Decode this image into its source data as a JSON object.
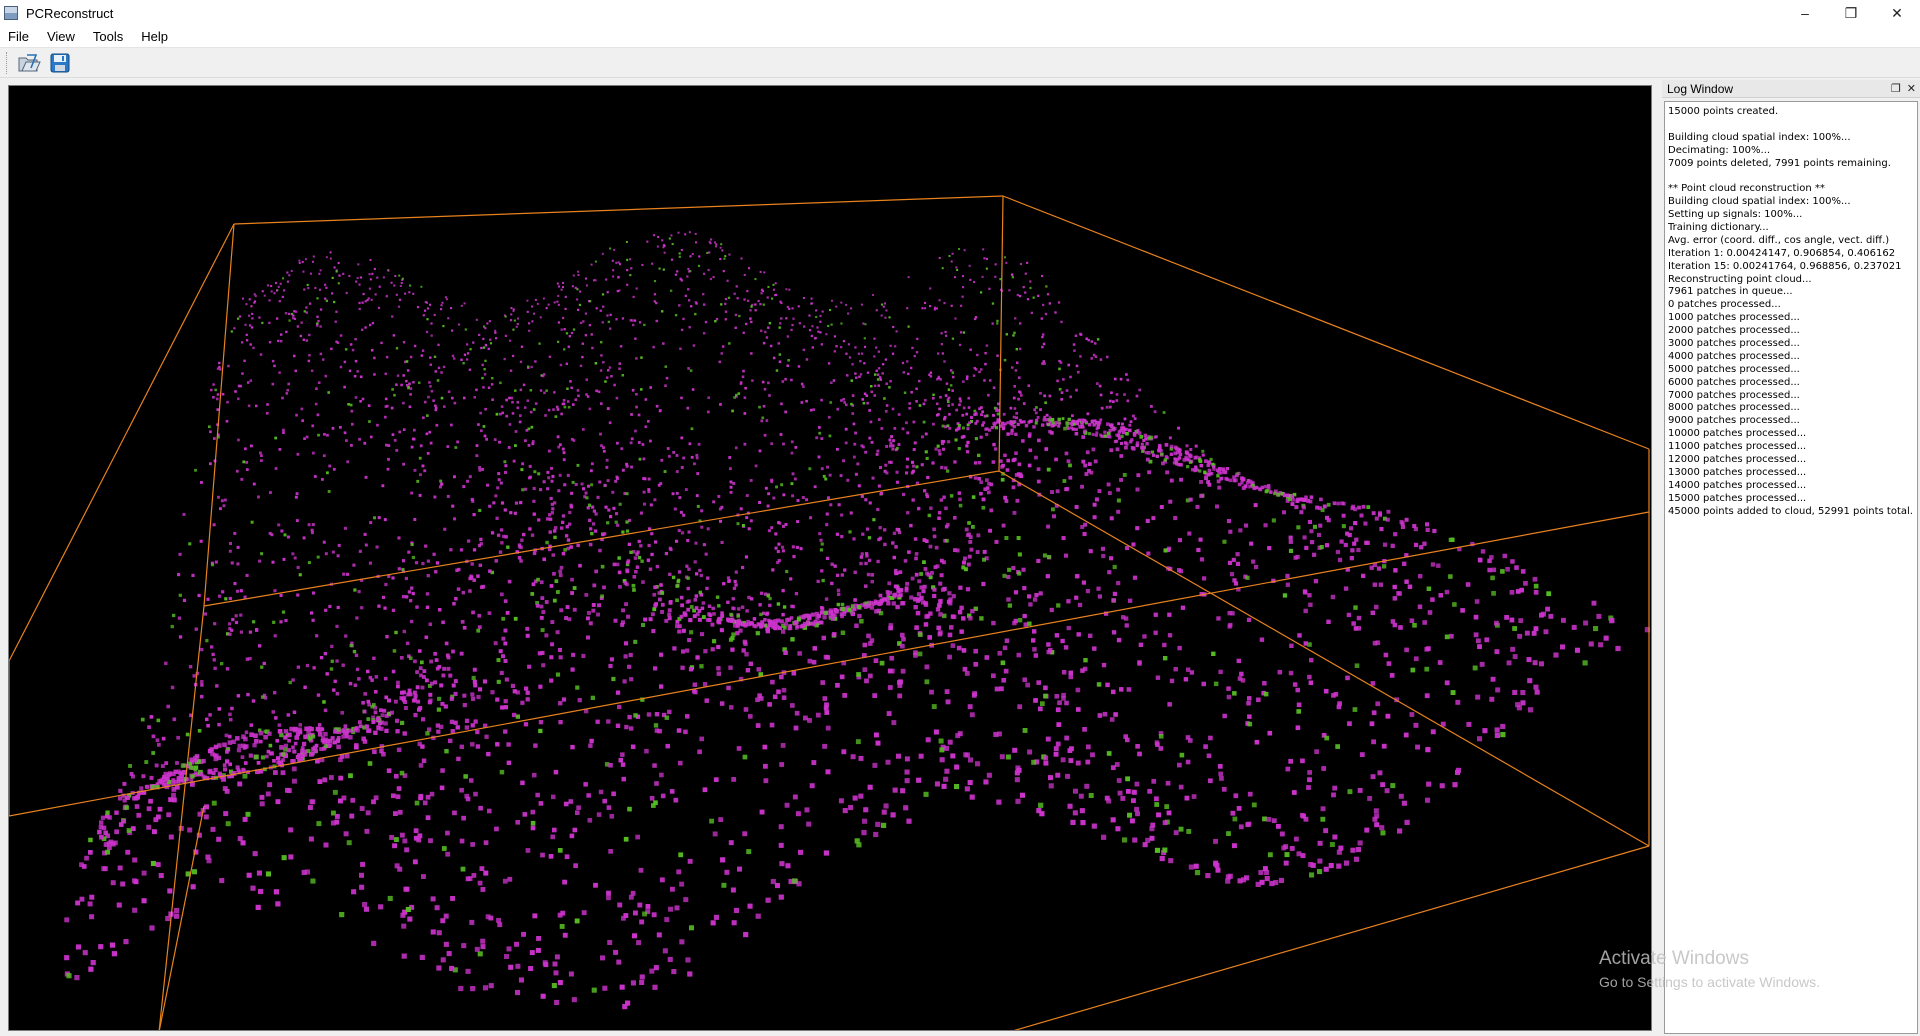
{
  "window": {
    "title": "PCReconstruct",
    "minimize": "–",
    "restore": "❐",
    "close": "✕"
  },
  "menu": {
    "items": [
      "File",
      "View",
      "Tools",
      "Help"
    ]
  },
  "toolbar": {
    "buttons": [
      {
        "icon": "open-folder-icon"
      },
      {
        "icon": "save-disk-icon"
      }
    ]
  },
  "viewport": {
    "background": "#000000",
    "bbox_color": "#e8821e",
    "point_colors": {
      "reconstructed": "#cc33cc",
      "original": "#55bb22"
    }
  },
  "log_window": {
    "title": "Log Window",
    "float_glyph": "❐",
    "close_glyph": "✕",
    "lines": [
      "15000 points created.",
      "",
      "Building cloud spatial index: 100%...",
      "Decimating: 100%...",
      "7009 points deleted, 7991 points remaining.",
      "",
      "** Point cloud reconstruction **",
      "Building cloud spatial index: 100%...",
      "Setting up signals: 100%...",
      "Training dictionary...",
      "Avg. error (coord. diff., cos angle, vect. diff.)",
      "Iteration 1: 0.00424147, 0.906854, 0.406162",
      "Iteration 15: 0.00241764, 0.968856, 0.237021",
      "Reconstructing point cloud...",
      "7961 patches in queue...",
      "0 patches processed...",
      "1000 patches processed...",
      "2000 patches processed...",
      "3000 patches processed...",
      "4000 patches processed...",
      "5000 patches processed...",
      "6000 patches processed...",
      "7000 patches processed...",
      "8000 patches processed...",
      "9000 patches processed...",
      "10000 patches processed...",
      "11000 patches processed...",
      "12000 patches processed...",
      "13000 patches processed...",
      "14000 patches processed...",
      "15000 patches processed...",
      "45000 points added to cloud, 52991 points total."
    ]
  },
  "watermark": {
    "line1": "Activate Windows",
    "line2": "Go to Settings to activate Windows."
  }
}
